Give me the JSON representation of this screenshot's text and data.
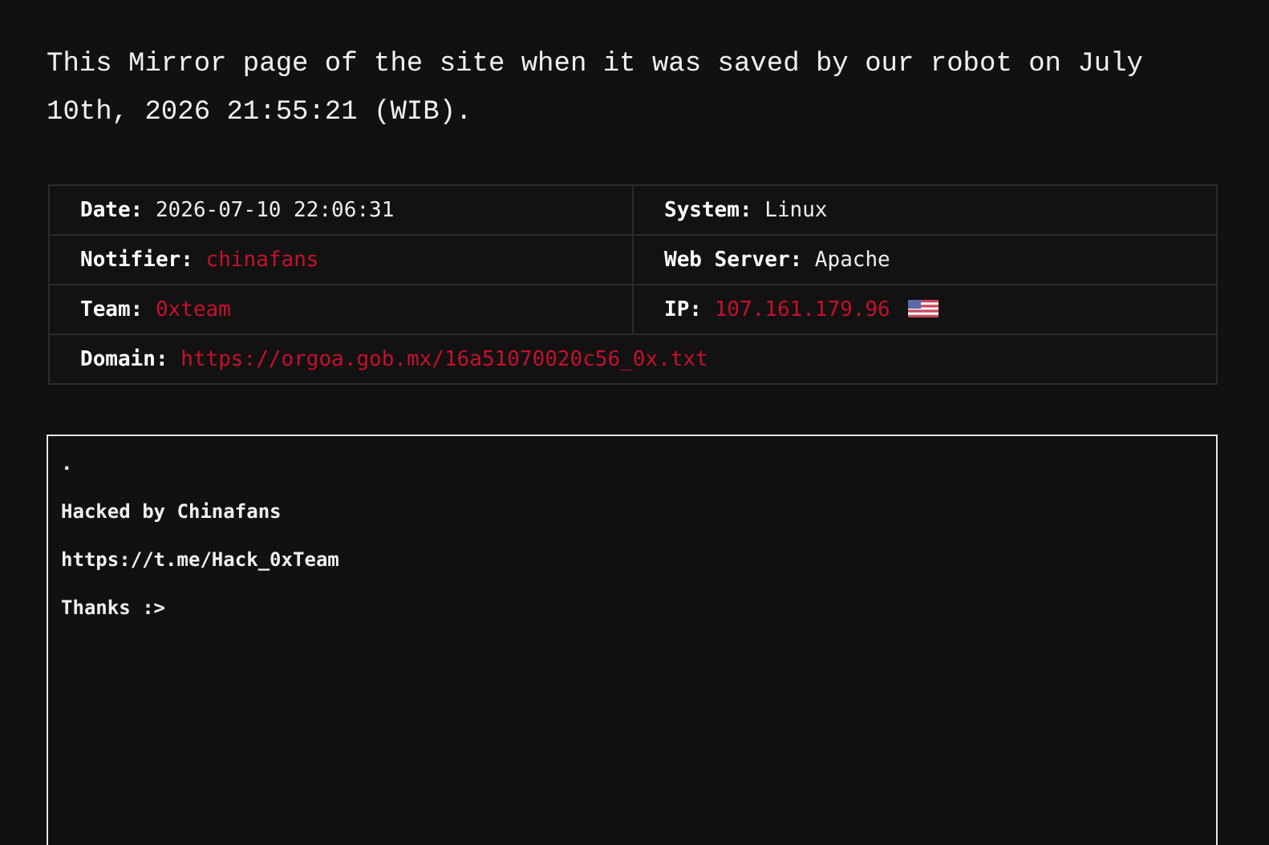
{
  "intro": "This Mirror page of the site when it was saved by our robot on July 10th, 2026 21:55:21 (WIB).",
  "info_rows": [
    [
      {
        "label": "Date:",
        "value": "2026-07-10 22:06:31",
        "kind": "plain"
      },
      {
        "label": "System:",
        "value": "Linux",
        "kind": "plain"
      }
    ],
    [
      {
        "label": "Notifier:",
        "value": "chinafans",
        "kind": "link"
      },
      {
        "label": "Web Server:",
        "value": "Apache",
        "kind": "plain"
      }
    ],
    [
      {
        "label": "Team:",
        "value": "0xteam",
        "kind": "link"
      },
      {
        "label": "IP:",
        "value": "107.161.179.96",
        "kind": "link",
        "flag": true
      }
    ],
    [
      {
        "label": "Domain:",
        "value": "https://orgoa.gob.mx/16a51070020c56_0x.txt",
        "kind": "link"
      }
    ]
  ],
  "mirror_lines": [
    ".",
    "Hacked by Chinafans",
    "https://t.me/Hack_0xTeam",
    "Thanks :>"
  ]
}
